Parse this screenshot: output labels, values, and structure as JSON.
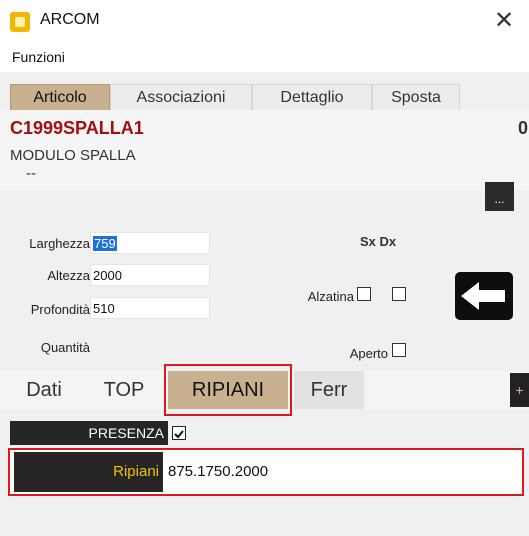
{
  "window": {
    "title": "ARCOM",
    "close_glyph": "✕",
    "app_icon": "arcom-app-icon"
  },
  "menu": {
    "items": [
      "Funzioni"
    ]
  },
  "top_tabs": [
    {
      "label": "Articolo",
      "active": true
    },
    {
      "label": "Associazioni",
      "active": false
    },
    {
      "label": "Dettaglio",
      "active": false
    },
    {
      "label": "Sposta",
      "active": false
    }
  ],
  "article": {
    "code": "C1999SPALLA1",
    "code_suffix": "0",
    "description": "MODULO SPALLA",
    "dash": "--",
    "more_button": "..."
  },
  "form": {
    "larghezza_label": "Larghezza",
    "larghezza_value": "759",
    "altezza_label": "Altezza",
    "altezza_value": "2000",
    "profondita_label": "Profondità",
    "profondita_value": "510",
    "quantita_label": "Quantità",
    "sxdx_label": "Sx Dx",
    "alzatina_label": "Alzatina",
    "aperto_label": "Aperto",
    "back_icon": "arrow-left-icon"
  },
  "bottom_tabs": [
    {
      "label": "Dati",
      "active": false
    },
    {
      "label": "TOP",
      "active": false
    },
    {
      "label": "RIPIANI",
      "active": true
    },
    {
      "label": "Ferr",
      "active": false
    }
  ],
  "plus_button": "+",
  "ripiani_section": {
    "presenza_label": "PRESENZA",
    "presenza_checked": true,
    "ripiani_label": "Ripiani",
    "ripiani_value": "875.1750.2000"
  },
  "colors": {
    "accent_tab": "#c9b18f",
    "highlight_red": "#d71920",
    "code_red": "#a01010"
  }
}
